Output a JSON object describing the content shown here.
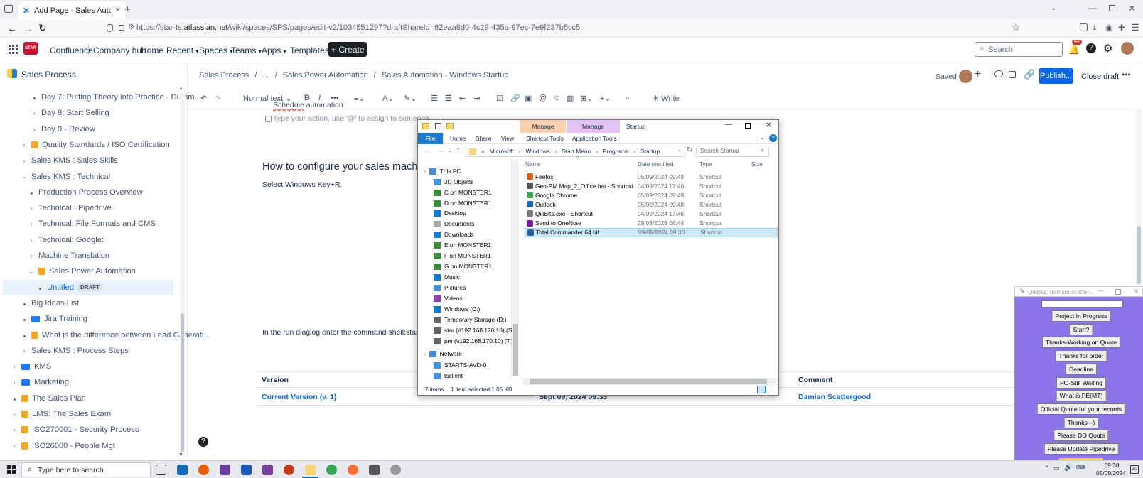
{
  "browser": {
    "tab_title": "Add Page - Sales Automation -",
    "url_pre": "https://star-ts.",
    "url_domain": "atlassian.net",
    "url_post": "/wiki/spaces/SPS/pages/edit-v2/1034551297?draftShareId=62eaa8d0-4c29-435a-97ec-7e9f237b5cc5",
    "new_tab": "+"
  },
  "nav": {
    "product": "Confluence",
    "company_hub": "Company hub",
    "home": "Home",
    "recent": "Recent",
    "spaces": "Spaces",
    "teams": "Teams",
    "apps": "Apps",
    "templates": "Templates",
    "create": "Create",
    "search_placeholder": "Search",
    "notif_count": "9+"
  },
  "sidebar": {
    "space_name": "Sales Process",
    "items": [
      {
        "label": "Day 7: Putting Theory into Practice - Dumm...",
        "kind": "dot"
      },
      {
        "label": "Day 8: Start Selling",
        "kind": "chev"
      },
      {
        "label": "Day 9 - Review",
        "kind": "chev"
      },
      {
        "label": "Quality Standards / ISO Certification",
        "kind": "chev-lock"
      },
      {
        "label": "Sales KMS : Sales Skills",
        "kind": "chev"
      },
      {
        "label": "Sales KMS : Technical",
        "kind": "open"
      },
      {
        "label": "Production Process Overview",
        "kind": "dot"
      },
      {
        "label": "Technical : Pipedrive",
        "kind": "chev"
      },
      {
        "label": "Technical: File Formats and CMS",
        "kind": "chev"
      },
      {
        "label": "Technical: Google:",
        "kind": "chev"
      },
      {
        "label": "Machine Translation",
        "kind": "chev"
      },
      {
        "label": "Sales Power Automation",
        "kind": "open-lock"
      },
      {
        "label": "Untitled",
        "kind": "draft",
        "badge": "DRAFT"
      },
      {
        "label": "Big Ideas List",
        "kind": "dot"
      },
      {
        "label": "Jira Training",
        "kind": "dot-folder"
      },
      {
        "label": "What is the difference between Lead Generati...",
        "kind": "dot-lock"
      },
      {
        "label": "Sales KMS : Process Steps",
        "kind": "chev"
      },
      {
        "label": "KMS",
        "kind": "chev-folder"
      },
      {
        "label": "Marketing",
        "kind": "chev-folder"
      },
      {
        "label": "The Sales Plan",
        "kind": "dot-lock"
      },
      {
        "label": "LMS: The Sales Exam",
        "kind": "chev-lock"
      },
      {
        "label": "ISO270001 - Security Process",
        "kind": "chev-lock"
      },
      {
        "label": "ISO26000 - People Mgt",
        "kind": "chev-lock"
      }
    ]
  },
  "editor": {
    "breadcrumbs": [
      "Sales Process",
      "...",
      "Sales Power Automation",
      "Sales Automation - Windows Startup"
    ],
    "saved": "Saved",
    "publish": "Publish...",
    "close_draft": "Close draft",
    "toolbar": {
      "text_style": "Normal text",
      "write": "Write"
    },
    "task_partial": "automation",
    "task_prefix": "Schedule",
    "task_placeholder": "Type your action, use '@' to assign to someone",
    "heading": "How to configure your sales machin",
    "para1": "Select Windows Key+R.",
    "para2": "In the run diaglog enter the command  shell:startu",
    "table": {
      "headers": [
        "Version",
        "Comment"
      ],
      "version_link": "Current Version",
      "version_num": "(v. 1)",
      "date": "Sept 09, 2024 09:33",
      "author": "Damian Scattergood"
    }
  },
  "explorer": {
    "title": "Startup",
    "manage1": "Manage",
    "manage2": "Manage",
    "ribbon": [
      "File",
      "Home",
      "Share",
      "View",
      "Shortcut Tools",
      "Application Tools"
    ],
    "path": [
      "Microsoft",
      "Windows",
      "Start Menu",
      "Programs",
      "Startup"
    ],
    "search_placeholder": "Search Startup",
    "columns": [
      "Name",
      "Date modified",
      "Type",
      "Size"
    ],
    "files": [
      {
        "name": "Firefox",
        "date": "05/09/2024 09:48",
        "type": "Shortcut",
        "color": "#e66000"
      },
      {
        "name": "Gen-PM Map_2_Office.bat - Shortcut",
        "date": "04/09/2024 17:46",
        "type": "Shortcut",
        "color": "#555555"
      },
      {
        "name": "Google Chrome",
        "date": "05/09/2024 09:49",
        "type": "Shortcut",
        "color": "#34a853"
      },
      {
        "name": "Outlook",
        "date": "05/09/2024 09:48",
        "type": "Shortcut",
        "color": "#0f6cbd"
      },
      {
        "name": "QikBits.exe - Shortcut",
        "date": "04/09/2024 17:46",
        "type": "Shortcut",
        "color": "#777777"
      },
      {
        "name": "Send to OneNote",
        "date": "29/08/2023 08:44",
        "type": "Shortcut",
        "color": "#7719aa"
      },
      {
        "name": "Total Commander 64 bit",
        "date": "09/09/2024 09:30",
        "type": "Shortcut",
        "color": "#2d5fa8"
      }
    ],
    "nav": [
      "This PC",
      "3D Objects",
      "C on MONSTER1",
      "D on MONSTER1",
      "Desktop",
      "Documents",
      "Downloads",
      "E on MONSTER1",
      "F on MONSTER1",
      "G on MONSTER1",
      "Music",
      "Pictures",
      "Videos",
      "Windows (C:)",
      "Temporary Storage (D:)",
      "star (\\\\192.168.170.10) (S:)",
      "pm (\\\\192.168.170.10) (T:)",
      "Network",
      "STARTS-AVD-0",
      "tsclient"
    ],
    "status_items": "7 items",
    "status_selected": "1 item selected  1.05 KB"
  },
  "qikbits": {
    "title": "QikBits: damian.scatter...",
    "buttons": [
      "Project In Progress",
      "Start?",
      "Thanks-Working on Quote",
      "Thanks for order",
      "Deadline",
      "PO-Still Waiting",
      "What is PE(MT)",
      "Official Quote for your records",
      "Thanks :-)",
      "Please DO Qoute",
      "Please Update Pipedrive"
    ]
  },
  "taskbar": {
    "search_placeholder": "Type here to search",
    "time": "09:38",
    "date": "09/09/2024",
    "notif": "20"
  }
}
